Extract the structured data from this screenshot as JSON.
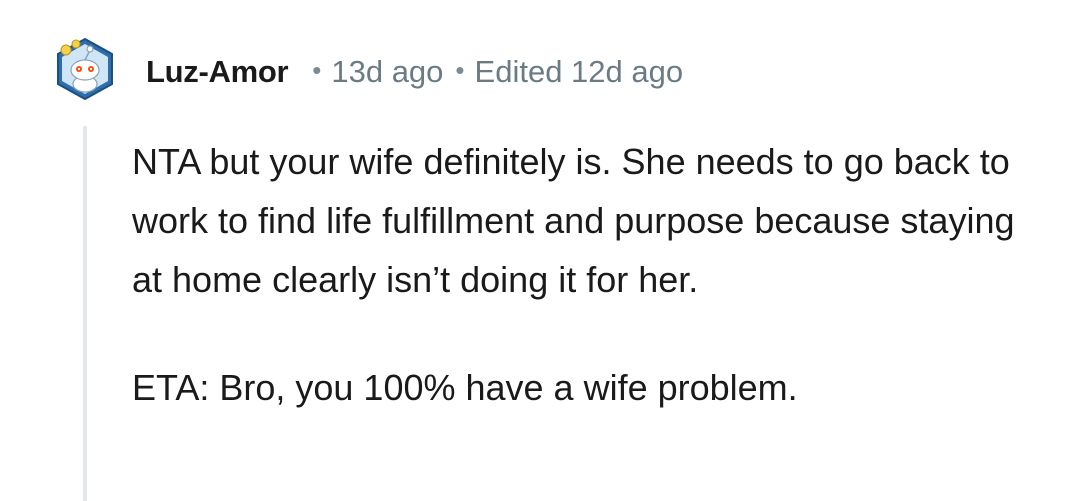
{
  "comment": {
    "username": "Luz-Amor",
    "time": "13d ago",
    "separator": "•",
    "edited": "Edited 12d ago",
    "avatar_icon": "snoo-avatar-icon",
    "paragraphs": [
      "NTA but your wife definitely is. She needs to go back to work to find life fulfillment and purpose because staying at home clearly isn’t doing it for her.",
      "ETA: Bro, you 100% have a wife problem."
    ]
  },
  "colors": {
    "text": "#1a1a1b",
    "meta": "#6b7b86",
    "thread_line": "#e4e7ea",
    "avatar_ring": "#2c6fae"
  }
}
